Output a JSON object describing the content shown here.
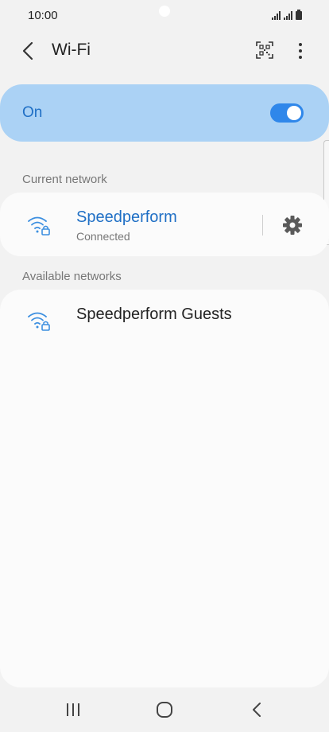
{
  "status_bar": {
    "time": "10:00"
  },
  "app_bar": {
    "title": "Wi-Fi"
  },
  "master_switch": {
    "label": "On",
    "state": "on",
    "accent": "#2f87ea",
    "background": "#abd2f5"
  },
  "current_network": {
    "section_title": "Current network",
    "name": "Speedperform",
    "status": "Connected",
    "icon": "wifi-lock-icon",
    "name_color": "#1f6fc5"
  },
  "available_networks": {
    "section_title": "Available networks",
    "items": [
      {
        "name": "Speedperform Guests",
        "icon": "wifi-lock-icon"
      }
    ]
  },
  "nav_bar": {
    "recents": "recents-icon",
    "home": "home-icon",
    "back": "back-icon"
  }
}
